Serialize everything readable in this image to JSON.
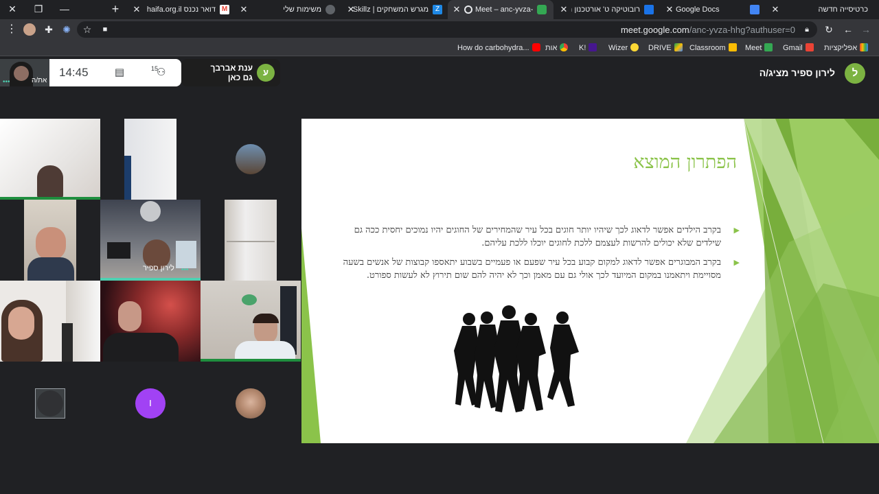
{
  "browser": {
    "tabs": [
      {
        "label": "כרטיסייה חדשה",
        "active": false
      },
      {
        "label": "Google Docs",
        "active": false
      },
      {
        "label": "רובוטיקה ט' אורטכנון ח",
        "active": false
      },
      {
        "label": "Meet – anc-yvza-hhg",
        "active": true
      },
      {
        "label": "מגרש המשחקים | Skillz",
        "active": false
      },
      {
        "label": "משימות שלי",
        "active": false
      },
      {
        "label": "דואר נכנס haifa.org.il",
        "active": false
      }
    ],
    "url_host": "meet.google.com",
    "url_path": "/anc-yvza-hhg?authuser=0",
    "bookmarks": [
      {
        "label": "אפליקציות",
        "icon": "apps-grid-icon"
      },
      {
        "label": "Gmail",
        "icon": "gmail-icon"
      },
      {
        "label": "Meet",
        "icon": "meet-icon"
      },
      {
        "label": "Classroom",
        "icon": "classroom-icon"
      },
      {
        "label": "DRIVE",
        "icon": "drive-icon"
      },
      {
        "label": "Wizer",
        "icon": "bulb-icon"
      },
      {
        "label": "K!",
        "icon": "kahoot-icon"
      },
      {
        "label": "אות",
        "icon": "chrome-icon"
      },
      {
        "label": "How do carbohydra...",
        "icon": "youtube-icon"
      }
    ]
  },
  "meet": {
    "self_label": "את/ה",
    "clock": "14:45",
    "participant_count": "15",
    "joined_notice": {
      "name": "ענת אברבך",
      "status": "גם כאן",
      "avatar_letter": "ע"
    },
    "presenter_label": "לירון ספיר מציג/ה",
    "presenter_avatar_letter": "ל",
    "tile_name": "לירון ספיר",
    "purple_avatar_letter": "ו",
    "colors": {
      "accent_green": "#8bc34a",
      "avatar_green": "#7cb342",
      "purple": "#a142f4",
      "active_speaker": "#4dd0b1"
    }
  },
  "slide": {
    "title": "הפתרון המוצא",
    "bullets": [
      "בקרב הילדים אפשר לדאוג לכך שיהיו יותר חוגים בכל עיר שהמחירים של החוגים יהיו נמוכים יחסית ככה גם שילדים שלא יכולים להרשות לעצמם ללכת לחוגים יוכלו ללכת עליהם.",
      "בקרב המבוגרים אפשר לדאוג למקום קבוע בכל עיר שפעם או פעמיים בשבוע יתאספו קבוצות של אנשים בשעה מסויימת ויתאמנו במקום המיועד לכך אולי גם עם מאמן וכך לא יהיה להם שום תירוץ לא לעשות ספורט."
    ]
  }
}
